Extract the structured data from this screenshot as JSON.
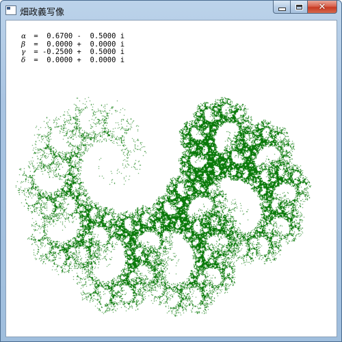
{
  "window": {
    "title": "畑政義写像",
    "icon": "app-window-icon",
    "caption_buttons": {
      "minimize": "minimize-icon",
      "maximize": "maximize-icon",
      "close": "close-icon",
      "close_glyph": "✕"
    }
  },
  "parameters": [
    {
      "symbol": "α",
      "value": " =  0.6700 -  0.5000 i"
    },
    {
      "symbol": "β",
      "value": " =  0.0000 +  0.0000 i"
    },
    {
      "symbol": "γ",
      "value": " = -0.2500 +  0.5000 i"
    },
    {
      "symbol": "δ",
      "value": " =  0.0000 +  0.0000 i"
    }
  ],
  "colors": {
    "fractal": "#0a7a0a",
    "background": "#ffffff"
  }
}
